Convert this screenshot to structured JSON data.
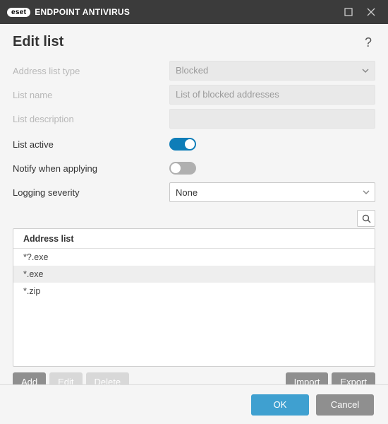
{
  "titlebar": {
    "brand_badge": "eset",
    "brand_text": "ENDPOINT ANTIVIRUS"
  },
  "header": {
    "title": "Edit list",
    "help": "?"
  },
  "form": {
    "type_label": "Address list type",
    "type_value": "Blocked",
    "name_label": "List name",
    "name_value": "List of blocked addresses",
    "desc_label": "List description",
    "desc_value": "",
    "active_label": "List active",
    "active_on": true,
    "notify_label": "Notify when applying",
    "notify_on": false,
    "severity_label": "Logging severity",
    "severity_value": "None"
  },
  "table": {
    "header": "Address list",
    "rows": [
      "*?.exe",
      "*.exe",
      "*.zip"
    ],
    "selected": 1
  },
  "actions": {
    "add": "Add",
    "edit": "Edit",
    "delete": "Delete",
    "import": "Import",
    "export": "Export"
  },
  "footer": {
    "ok": "OK",
    "cancel": "Cancel"
  }
}
